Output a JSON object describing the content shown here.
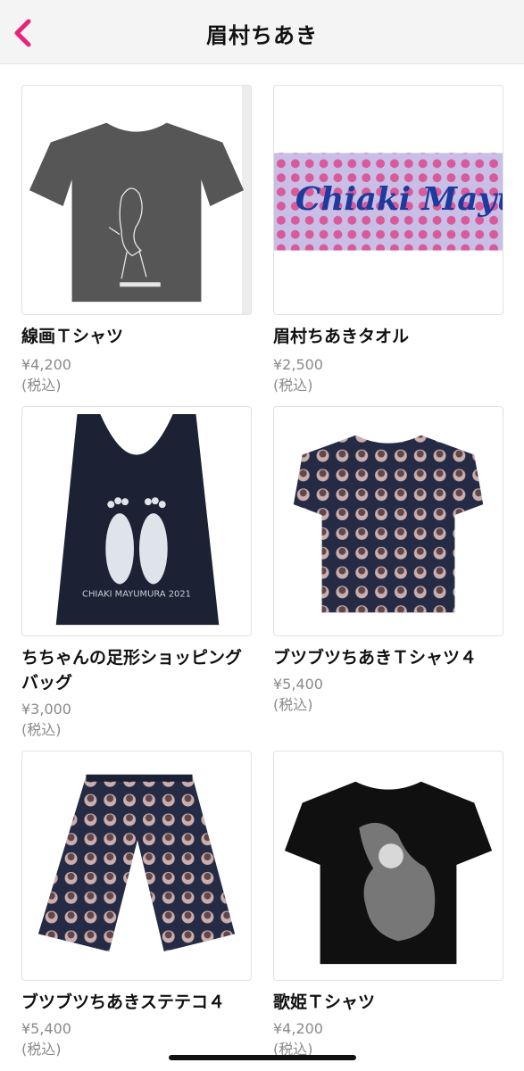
{
  "header": {
    "title": "眉村ちあき",
    "back_icon": "chevron-left-icon",
    "accent_color": "#e8237a"
  },
  "products": [
    {
      "name": "線画Ｔシャツ",
      "price": "¥4,200 (税込)"
    },
    {
      "name": "眉村ちあきタオル",
      "price": "¥2,500 (税込)",
      "print_text": "Chiaki Mayumura"
    },
    {
      "name": "ちちゃんの足形ショッピングバッグ",
      "price": "¥3,000 (税込)",
      "print_text": "CHIAKI MAYUMURA 2021"
    },
    {
      "name": "ブツブツちあきＴシャツ４",
      "price": "¥5,400 (税込)"
    },
    {
      "name": "ブツブツちあきステテコ４",
      "price": "¥5,400 (税込)"
    },
    {
      "name": "歌姫Ｔシャツ",
      "price": "¥4,200 (税込)"
    }
  ]
}
